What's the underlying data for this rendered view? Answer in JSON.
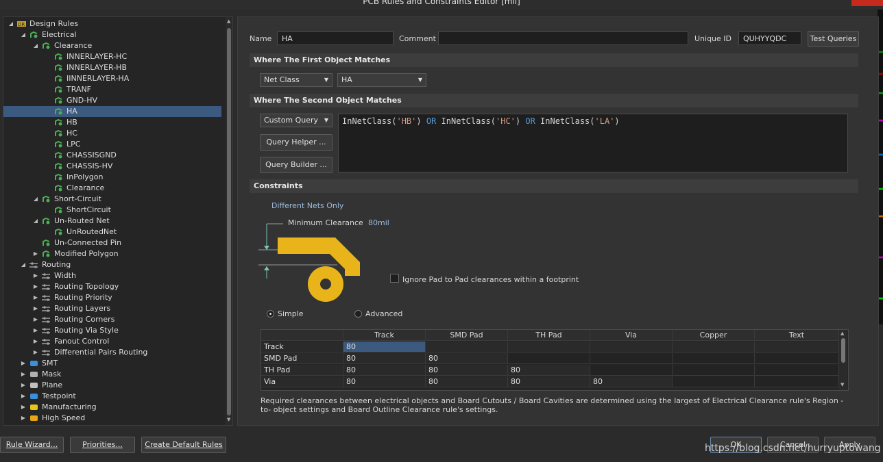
{
  "window": {
    "title": "PCB Rules and Constraints Editor [mil]"
  },
  "tree": {
    "items": [
      {
        "label": "Design Rules",
        "level": 0,
        "expanded": true,
        "icon": "design-rules-icon"
      },
      {
        "label": "Electrical",
        "level": 1,
        "expanded": true,
        "icon": "electrical-icon"
      },
      {
        "label": "Clearance",
        "level": 2,
        "expanded": true,
        "icon": "rule-icon"
      },
      {
        "label": "INNERLAYER-HC",
        "level": 3,
        "icon": "rule-icon"
      },
      {
        "label": "INNERLAYER-HB",
        "level": 3,
        "icon": "rule-icon"
      },
      {
        "label": "IINNERLAYER-HA",
        "level": 3,
        "icon": "rule-icon"
      },
      {
        "label": "TRANF",
        "level": 3,
        "icon": "rule-icon"
      },
      {
        "label": "GND-HV",
        "level": 3,
        "icon": "rule-icon"
      },
      {
        "label": "HA",
        "level": 3,
        "icon": "rule-icon",
        "selected": true
      },
      {
        "label": "HB",
        "level": 3,
        "icon": "rule-icon"
      },
      {
        "label": "HC",
        "level": 3,
        "icon": "rule-icon"
      },
      {
        "label": "LPC",
        "level": 3,
        "icon": "rule-icon"
      },
      {
        "label": "CHASSISGND",
        "level": 3,
        "icon": "rule-icon"
      },
      {
        "label": "CHASSIS-HV",
        "level": 3,
        "icon": "rule-icon"
      },
      {
        "label": "InPolygon",
        "level": 3,
        "icon": "rule-icon"
      },
      {
        "label": "Clearance",
        "level": 3,
        "icon": "rule-icon"
      },
      {
        "label": "Short-Circuit",
        "level": 2,
        "expanded": true,
        "icon": "rule-icon"
      },
      {
        "label": "ShortCircuit",
        "level": 3,
        "icon": "rule-icon"
      },
      {
        "label": "Un-Routed Net",
        "level": 2,
        "expanded": true,
        "icon": "rule-icon"
      },
      {
        "label": "UnRoutedNet",
        "level": 3,
        "icon": "rule-icon"
      },
      {
        "label": "Un-Connected Pin",
        "level": 2,
        "icon": "rule-icon"
      },
      {
        "label": "Modified Polygon",
        "level": 2,
        "collapsed": true,
        "icon": "rule-icon"
      },
      {
        "label": "Routing",
        "level": 1,
        "expanded": true,
        "icon": "routing-icon"
      },
      {
        "label": "Width",
        "level": 2,
        "collapsed": true,
        "icon": "routing-icon"
      },
      {
        "label": "Routing Topology",
        "level": 2,
        "collapsed": true,
        "icon": "routing-icon"
      },
      {
        "label": "Routing Priority",
        "level": 2,
        "collapsed": true,
        "icon": "routing-icon"
      },
      {
        "label": "Routing Layers",
        "level": 2,
        "collapsed": true,
        "icon": "routing-icon"
      },
      {
        "label": "Routing Corners",
        "level": 2,
        "collapsed": true,
        "icon": "routing-icon"
      },
      {
        "label": "Routing Via Style",
        "level": 2,
        "collapsed": true,
        "icon": "routing-icon"
      },
      {
        "label": "Fanout Control",
        "level": 2,
        "collapsed": true,
        "icon": "routing-icon"
      },
      {
        "label": "Differential Pairs Routing",
        "level": 2,
        "collapsed": true,
        "icon": "routing-icon"
      },
      {
        "label": "SMT",
        "level": 1,
        "collapsed": true,
        "icon": "smt-icon"
      },
      {
        "label": "Mask",
        "level": 1,
        "collapsed": true,
        "icon": "mask-icon"
      },
      {
        "label": "Plane",
        "level": 1,
        "collapsed": true,
        "icon": "plane-icon"
      },
      {
        "label": "Testpoint",
        "level": 1,
        "collapsed": true,
        "icon": "testpoint-icon"
      },
      {
        "label": "Manufacturing",
        "level": 1,
        "collapsed": true,
        "icon": "manufacturing-icon"
      },
      {
        "label": "High Speed",
        "level": 1,
        "collapsed": true,
        "icon": "high-speed-icon"
      }
    ]
  },
  "rule": {
    "name_label": "Name",
    "name_value": "HA",
    "comment_label": "Comment",
    "comment_value": "",
    "uid_label": "Unique ID",
    "uid_value": "QUHYYQDC",
    "test_queries": "Test Queries"
  },
  "first_match": {
    "title": "Where The First Object Matches",
    "type": "Net Class",
    "value": "HA"
  },
  "second_match": {
    "title": "Where The Second Object Matches",
    "type": "Custom Query",
    "query_helper": "Query Helper ...",
    "query_builder": "Query Builder ...",
    "query_tokens": [
      {
        "t": "InNetClass(",
        "k": "fn"
      },
      {
        "t": "'HB'",
        "k": "str"
      },
      {
        "t": ") ",
        "k": "fn"
      },
      {
        "t": "OR",
        "k": "kw"
      },
      {
        "t": " InNetClass(",
        "k": "fn"
      },
      {
        "t": "'HC'",
        "k": "str"
      },
      {
        "t": ") ",
        "k": "fn"
      },
      {
        "t": "OR",
        "k": "kw"
      },
      {
        "t": " InNetClass(",
        "k": "fn"
      },
      {
        "t": "'LA'",
        "k": "str"
      },
      {
        "t": ")",
        "k": "fn"
      }
    ]
  },
  "constraints": {
    "title": "Constraints",
    "net_scope": "Different Nets Only",
    "min_clearance_label": "Minimum Clearance",
    "min_clearance_value": "80mil",
    "ignore_pad_label": "Ignore Pad to Pad clearances within a footprint",
    "ignore_pad_checked": false,
    "mode_simple": "Simple",
    "mode_advanced": "Advanced",
    "mode_selected": "Simple",
    "graphic_color": "#e8b41a",
    "table": {
      "columns": [
        "",
        "Track",
        "SMD Pad",
        "TH Pad",
        "Via",
        "Copper",
        "Text"
      ],
      "rows": [
        {
          "label": "Track",
          "cells": [
            "80",
            "",
            "",
            "",
            "",
            ""
          ]
        },
        {
          "label": "SMD Pad",
          "cells": [
            "80",
            "80",
            "",
            "",
            "",
            ""
          ]
        },
        {
          "label": "TH Pad",
          "cells": [
            "80",
            "80",
            "80",
            "",
            "",
            ""
          ]
        },
        {
          "label": "Via",
          "cells": [
            "80",
            "80",
            "80",
            "80",
            "",
            ""
          ]
        }
      ]
    },
    "note": "Required clearances between electrical objects and Board Cutouts / Board Cavities are determined using the largest of Electrical Clearance rule's Region -to- object settings and Board Outline Clearance rule's settings."
  },
  "footer": {
    "rule_wizard": "Rule Wizard...",
    "priorities": "Priorities...",
    "create_default": "Create Default Rules",
    "ok": "OK",
    "cancel": "Cancel",
    "apply": "Apply",
    "watermark": "https://blog.csdn.net/hurryuptowang"
  }
}
